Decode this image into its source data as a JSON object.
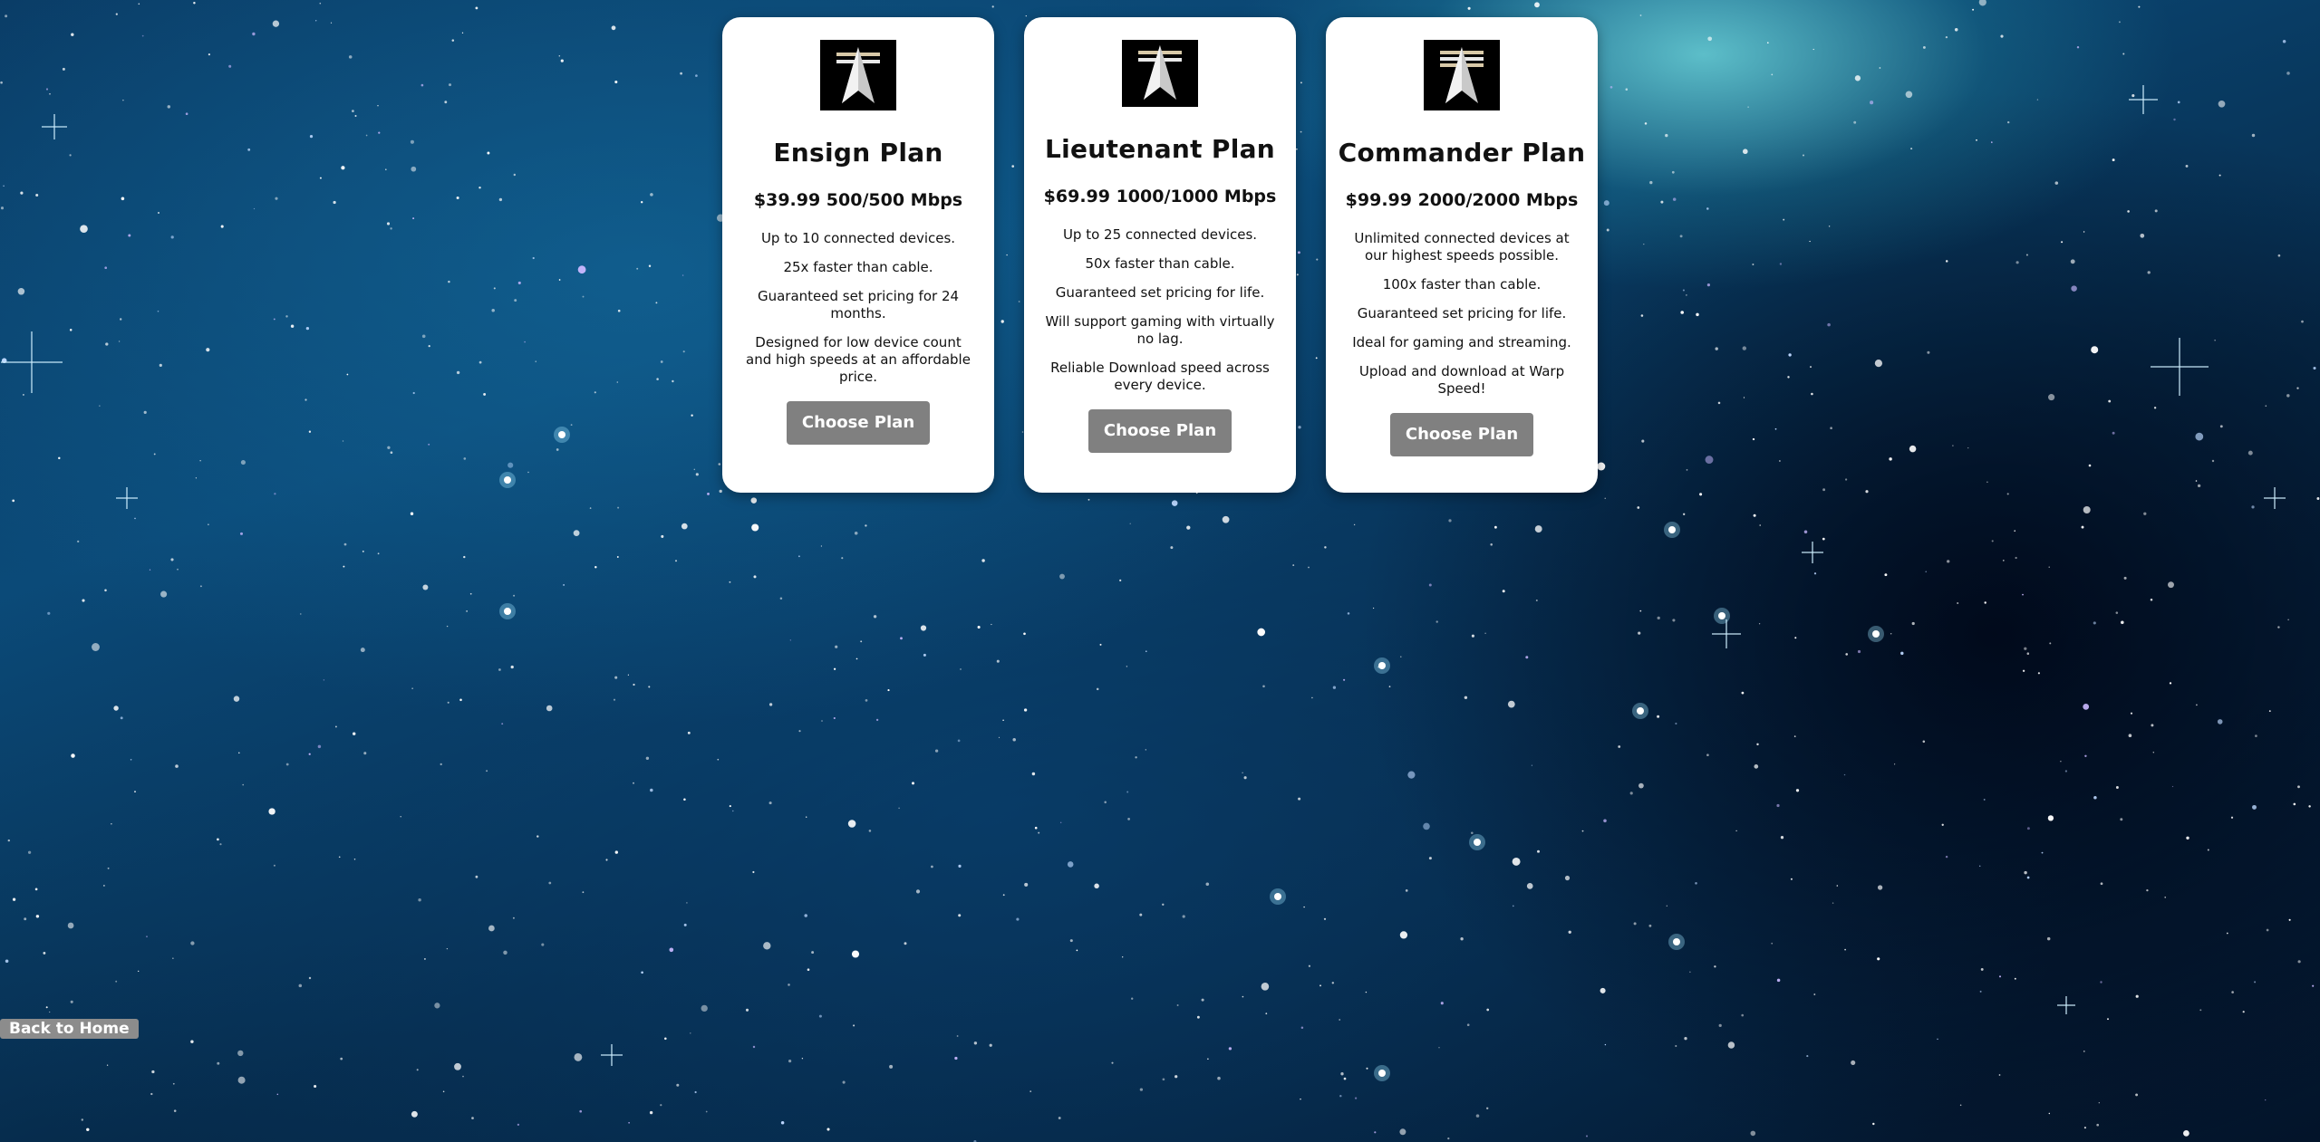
{
  "plans": [
    {
      "title": "Ensign Plan",
      "price": "$39.99 500/500 Mbps",
      "features": [
        "Up to 10 connected devices.",
        "25x faster than cable.",
        "Guaranteed set pricing for 24 months.",
        "Designed for low device count and high speeds at an affordable price."
      ],
      "button_label": "Choose Plan",
      "icon": "starfleet-delta-icon"
    },
    {
      "title": "Lieutenant Plan",
      "price": "$69.99 1000/1000 Mbps",
      "features": [
        "Up to 25 connected devices.",
        "50x faster than cable.",
        "Guaranteed set pricing for life.",
        "Will support gaming with virtually no lag.",
        "Reliable Download speed across every device."
      ],
      "button_label": "Choose Plan",
      "icon": "starfleet-delta-icon"
    },
    {
      "title": "Commander Plan",
      "price": "$99.99 2000/2000 Mbps",
      "features": [
        "Unlimited connected devices at our highest speeds possible.",
        "100x faster than cable.",
        "Guaranteed set pricing for life.",
        "Ideal for gaming and streaming.",
        "Upload and download at Warp Speed!"
      ],
      "button_label": "Choose Plan",
      "icon": "starfleet-delta-icon"
    }
  ],
  "back_link": "Back to Home",
  "colors": {
    "card_bg": "#ffffff",
    "button_bg": "#808080",
    "back_bg": "#8c8c8c",
    "space_bg": "#0b4a78"
  }
}
